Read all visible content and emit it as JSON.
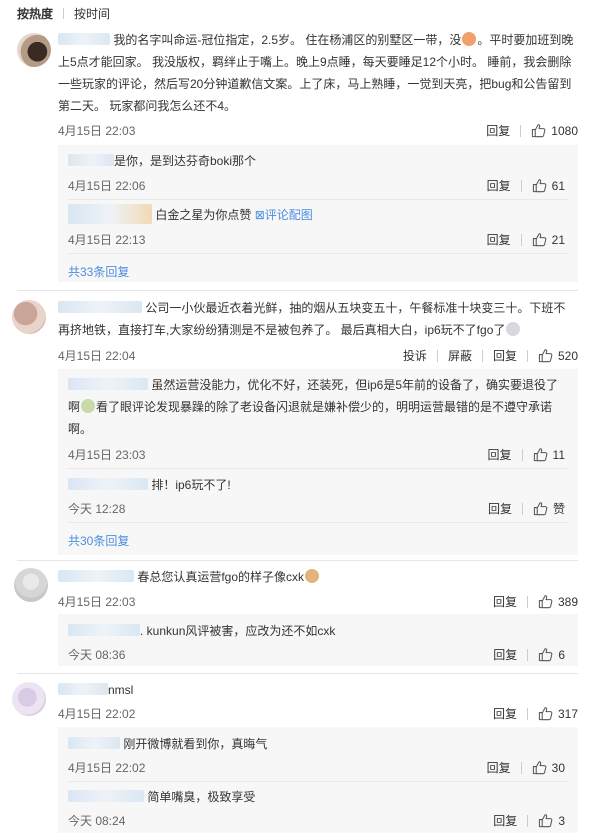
{
  "tabs": {
    "hot": "按热度",
    "time": "按时间"
  },
  "labels": {
    "reply": "回复",
    "report": "投诉",
    "block": "屏蔽",
    "like": "赞"
  },
  "colors": {
    "link": "#4c8ee0",
    "sub_bg": "#f7f7f7"
  },
  "c1": {
    "line1": "我的名字叫命运-冠位指定，2.5岁。 住在杨浦区的别墅区一带，没",
    "line1b": "。平时要加班到晚",
    "line2": "上5点才能回家。 我没版权，羁绊止于嘴上。晚上9点睡，每天要睡足12个小时。 睡前，我会删除",
    "line3": "一些玩家的评论，然后写20分钟道歉信文案。上了床，马上熟睡，一觉到天亮，把bug和公告留到",
    "line4": "第二天。 玩家都问我怎么还不4。",
    "time": "4月15日 22:03",
    "likes": "1080",
    "r1": {
      "text": "是你，是到达芬奇boki那个",
      "time": "4月15日 22:06",
      "likes": "61"
    },
    "r2": {
      "text": "白金之星为你点赞",
      "link": "评论配图",
      "time": "4月15日 22:13",
      "likes": "21"
    },
    "more": "共33条回复"
  },
  "c2": {
    "line1": "公司一小伙最近衣着光鲜，抽的烟从五块变五十，午餐标准十块变三十。下班不",
    "line2": "再挤地铁，直接打车,大家纷纷猜测是不是被包养了。 最后真相大白，ip6玩不了fgo了",
    "time": "4月15日 22:04",
    "likes": "520",
    "r1": {
      "line1": "虽然运营没能力，优化不好，还装死，但ip6是5年前的设备了，确实要退役了",
      "line2a": "啊",
      "line2b": "看了眼评论发现暴躁的除了老设备闪退就是嫌补偿少的，明明运营最错的是不遵守承诺",
      "line3": "啊。",
      "time": "4月15日 23:03",
      "likes": "11"
    },
    "r2": {
      "text": "排！ip6玩不了!",
      "time": "今天 12:28"
    },
    "more": "共30条回复"
  },
  "c3": {
    "text": "春总您认真运营fgo的样子像cxk",
    "time": "4月15日 22:03",
    "likes": "389",
    "r1": {
      "text": ". kunkun风评被害，应改为还不如cxk",
      "time": "今天 08:36",
      "likes": "6"
    }
  },
  "c4": {
    "text": "nmsl",
    "time": "4月15日 22:02",
    "likes": "317",
    "r1": {
      "text": "刚开微博就看到你，真晦气",
      "time": "4月15日 22:02",
      "likes": "30"
    },
    "r2": {
      "text": "简单嘴臭，极致享受",
      "time": "今天 08:24",
      "likes": "3"
    }
  }
}
